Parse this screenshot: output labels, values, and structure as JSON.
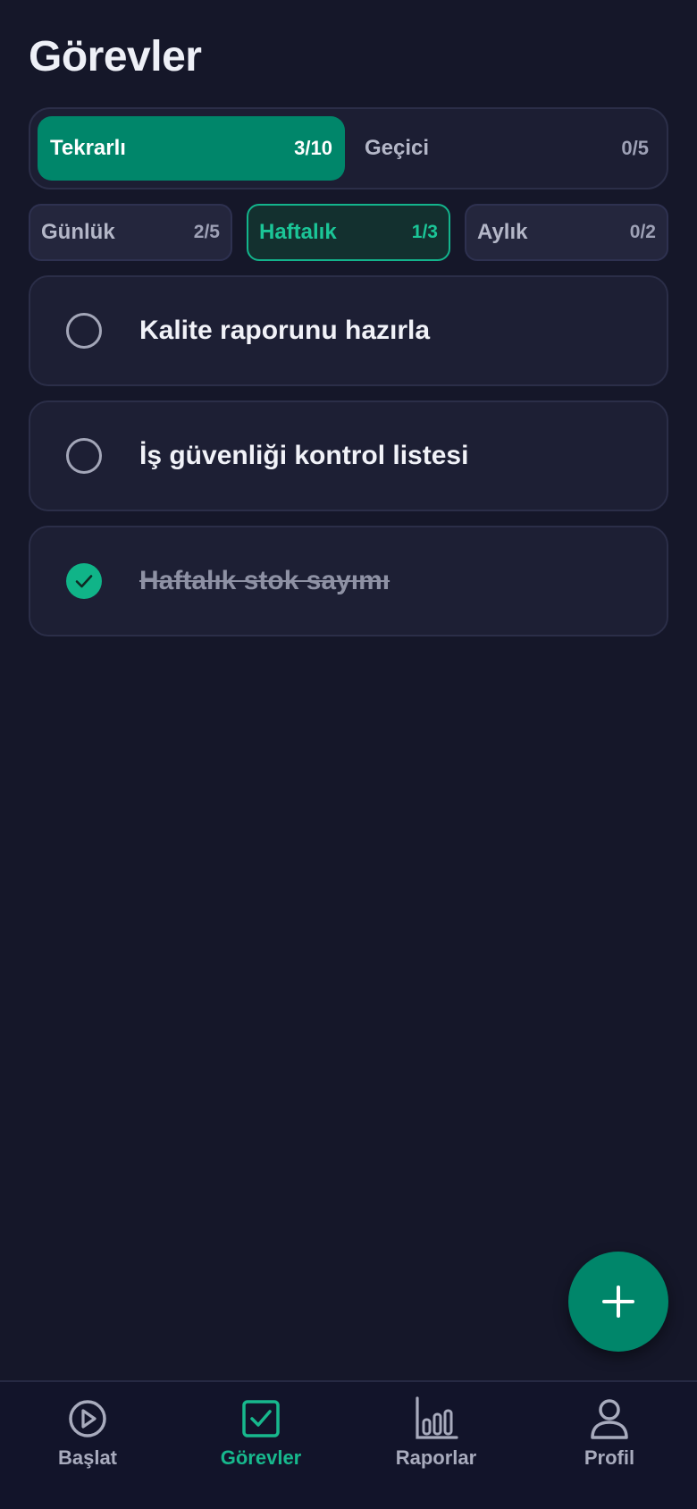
{
  "header": {
    "title": "Görevler"
  },
  "type_tabs": [
    {
      "label": "Tekrarlı",
      "count": "3/10",
      "active": true
    },
    {
      "label": "Geçici",
      "count": "0/5",
      "active": false
    }
  ],
  "period_chips": [
    {
      "label": "Günlük",
      "count": "2/5",
      "active": false
    },
    {
      "label": "Haftalık",
      "count": "1/3",
      "active": true
    },
    {
      "label": "Aylık",
      "count": "0/2",
      "active": false
    }
  ],
  "tasks": [
    {
      "title": "Kalite raporunu hazırla",
      "done": false
    },
    {
      "title": "İş güvenliği kontrol listesi",
      "done": false
    },
    {
      "title": "Haftalık stok sayımı",
      "done": true
    }
  ],
  "fab": {
    "icon": "plus-icon"
  },
  "bottom_nav": [
    {
      "label": "Başlat",
      "icon": "play-circle-icon",
      "active": false
    },
    {
      "label": "Görevler",
      "icon": "checkbox-icon",
      "active": true
    },
    {
      "label": "Raporlar",
      "icon": "bar-chart-icon",
      "active": false
    },
    {
      "label": "Profil",
      "icon": "user-icon",
      "active": false
    }
  ],
  "colors": {
    "background": "#151729",
    "accent": "#00866a",
    "accent_text": "#17b88d",
    "card": "#1d1f34"
  }
}
